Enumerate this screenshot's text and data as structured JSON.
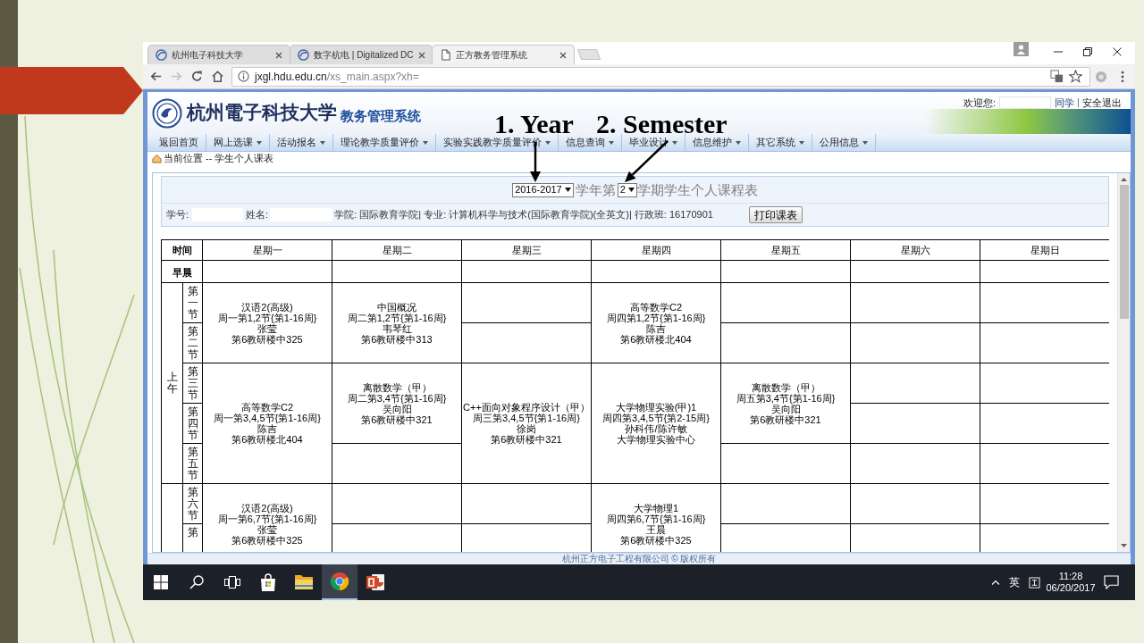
{
  "slide": {
    "annotations": [
      {
        "text": "1. Year"
      },
      {
        "text": "2. Semester"
      }
    ]
  },
  "browser": {
    "tabs": [
      {
        "title": "杭州电子科技大学",
        "kind": "site",
        "selected": false
      },
      {
        "title": "数字杭电 | Digitalized DC",
        "kind": "site",
        "selected": false
      },
      {
        "title": "正方教务管理系统",
        "kind": "page",
        "selected": true
      }
    ],
    "forward_disabled": true,
    "url": {
      "host": "jxgl.hdu.edu.cn",
      "path": "/xs_main.aspx?xh="
    }
  },
  "site": {
    "school_name": "杭州電子科技大学",
    "system_name": "教务管理系统",
    "welcome": "欢迎您:",
    "user_suffix": "同学",
    "logout": "安全退出",
    "nav": [
      {
        "label": "返回首页",
        "dropdown": false
      },
      {
        "label": "网上选课",
        "dropdown": true
      },
      {
        "label": "活动报名",
        "dropdown": true
      },
      {
        "label": "理论教学质量评价",
        "dropdown": true
      },
      {
        "label": "实验实践教学质量评价",
        "dropdown": true
      },
      {
        "label": "信息查询",
        "dropdown": true
      },
      {
        "label": "毕业设计",
        "dropdown": true
      },
      {
        "label": "信息维护",
        "dropdown": true
      },
      {
        "label": "其它系统",
        "dropdown": true
      },
      {
        "label": "公用信息",
        "dropdown": true
      }
    ],
    "breadcrumb": "当前位置 -- 学生个人课表",
    "footer": "杭州正方电子工程有限公司 © 版权所有"
  },
  "schedule": {
    "year": "2016-2017",
    "year_suffix": "学年第",
    "semester": "2",
    "title_suffix": "学期学生个人课程表",
    "student_id_label": "学号:",
    "name_label": "姓名:",
    "details": "学院: 国际教育学院| 专业: 计算机科学与技术(国际教育学院)(全英文)| 行政班: 16170901",
    "print_button": "打印课表",
    "columns": [
      "时间",
      "星期一",
      "星期二",
      "星期三",
      "星期四",
      "星期五",
      "星期六",
      "星期日"
    ],
    "morning_label": "早晨",
    "sessions": [
      {
        "label": "上午",
        "rows": [
          {
            "period": "第一节",
            "cells": [
              {
                "kind": "course",
                "name": "汉语2(高级)",
                "schedule": "周一第1,2节{第1-16周}",
                "teacher": "张莹",
                "room": "第6教研楼中325"
              },
              {
                "kind": "course",
                "name": "中国概况",
                "schedule": "周二第1,2节{第1-16周}",
                "teacher": "韦琴红",
                "room": "第6教研楼中313"
              },
              {
                "kind": "empty"
              },
              {
                "kind": "course",
                "name": "高等数学C2",
                "schedule": "周四第1,2节{第1-16周}",
                "teacher": "陈吉",
                "room": "第6教研楼北404"
              },
              {
                "kind": "empty"
              },
              {
                "kind": "empty"
              },
              {
                "kind": "empty"
              }
            ]
          },
          {
            "period": "第二节",
            "cells": [
              {
                "kind": "merged"
              },
              {
                "kind": "merged"
              },
              {
                "kind": "empty"
              },
              {
                "kind": "merged"
              },
              {
                "kind": "empty"
              },
              {
                "kind": "empty"
              },
              {
                "kind": "empty"
              }
            ]
          },
          {
            "period": "第三节",
            "cells": [
              {
                "kind": "course",
                "name": "高等数学C2",
                "schedule": "周一第3,4,5节{第1-16周}",
                "teacher": "陈吉",
                "room": "第6教研楼北404"
              },
              {
                "kind": "course",
                "name": "离散数学（甲）",
                "schedule": "周二第3,4节{第1-16周}",
                "teacher": "吴向阳",
                "room": "第6教研楼中321"
              },
              {
                "kind": "course",
                "name": "C++面向对象程序设计（甲）",
                "schedule": "周三第3,4,5节{第1-16周}",
                "teacher": "徐岗",
                "room": "第6教研楼中321"
              },
              {
                "kind": "course",
                "name": "大学物理实验(甲)1",
                "schedule": "周四第3,4,5节{第2-15周}",
                "teacher": "孙科伟/陈许敏",
                "room": "大学物理实验中心"
              },
              {
                "kind": "course",
                "name": "离散数学（甲）",
                "schedule": "周五第3,4节{第1-16周}",
                "teacher": "吴向阳",
                "room": "第6教研楼中321"
              },
              {
                "kind": "empty"
              },
              {
                "kind": "empty"
              }
            ]
          },
          {
            "period": "第四节",
            "cells": [
              {
                "kind": "merged"
              },
              {
                "kind": "merged"
              },
              {
                "kind": "merged"
              },
              {
                "kind": "merged"
              },
              {
                "kind": "merged"
              },
              {
                "kind": "empty"
              },
              {
                "kind": "empty"
              }
            ]
          },
          {
            "period": "第五节",
            "cells": [
              {
                "kind": "merged"
              },
              {
                "kind": "empty"
              },
              {
                "kind": "merged"
              },
              {
                "kind": "merged"
              },
              {
                "kind": "empty"
              },
              {
                "kind": "empty"
              },
              {
                "kind": "empty"
              }
            ]
          }
        ]
      },
      {
        "rows": [
          {
            "period": "第六节",
            "cells": [
              {
                "kind": "course",
                "name": "汉语2(高级)",
                "schedule": "周一第6,7节{第1-16周}",
                "teacher": "张莹",
                "room": "第6教研楼中325"
              },
              {
                "kind": "empty"
              },
              {
                "kind": "empty"
              },
              {
                "kind": "course",
                "name": "大学物理1",
                "schedule": "周四第6,7节{第1-16周}",
                "teacher": "王晨",
                "room": "第6教研楼中325"
              },
              {
                "kind": "empty"
              },
              {
                "kind": "empty"
              },
              {
                "kind": "empty"
              }
            ]
          },
          {
            "period": "第",
            "cells": [
              {
                "kind": "merged"
              },
              {
                "kind": "empty"
              },
              {
                "kind": "empty"
              },
              {
                "kind": "merged"
              },
              {
                "kind": "empty"
              },
              {
                "kind": "empty"
              },
              {
                "kind": "empty"
              }
            ]
          }
        ]
      }
    ]
  },
  "taskbar": {
    "apps": [
      {
        "kind": "store",
        "active": false
      },
      {
        "kind": "explorer",
        "active": false
      },
      {
        "kind": "chrome",
        "active": true
      },
      {
        "kind": "powerpoint",
        "active": false
      }
    ],
    "input_language": "英",
    "time": "11:28",
    "date": "06/20/2017"
  }
}
